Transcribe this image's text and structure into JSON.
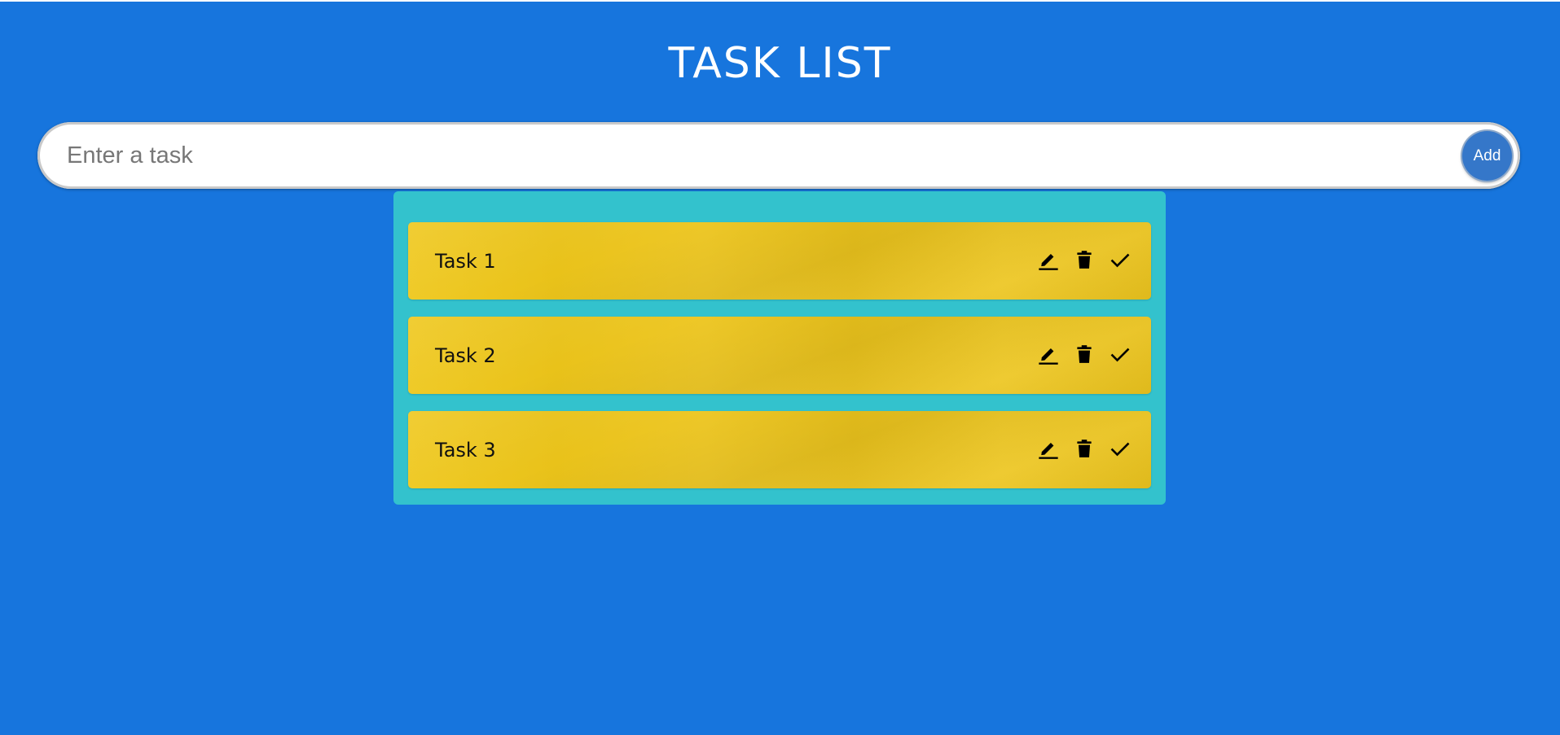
{
  "header": {
    "title": "TASK LIST"
  },
  "input": {
    "placeholder": "Enter a task",
    "value": "",
    "add_label": "Add"
  },
  "tasks": [
    {
      "label": "Task 1",
      "actions": [
        "edit-icon",
        "delete-icon",
        "complete-icon"
      ]
    },
    {
      "label": "Task 2",
      "actions": [
        "edit-icon",
        "delete-icon",
        "complete-icon"
      ]
    },
    {
      "label": "Task 3",
      "actions": [
        "edit-icon",
        "delete-icon",
        "complete-icon"
      ]
    }
  ],
  "colors": {
    "background": "#1775dd",
    "panel": "#33c2cd",
    "task_card": "#ebc51f",
    "add_button": "#3577c9"
  }
}
